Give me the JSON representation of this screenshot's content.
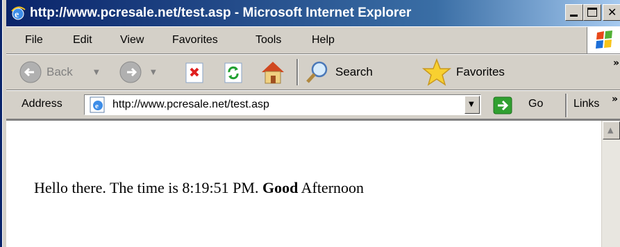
{
  "window": {
    "title": "http://www.pcresale.net/test.asp - Microsoft Internet Explorer"
  },
  "menu": {
    "items": [
      "File",
      "Edit",
      "View",
      "Favorites",
      "Tools",
      "Help"
    ]
  },
  "toolbar": {
    "back_label": "Back",
    "search_label": "Search",
    "favorites_label": "Favorites"
  },
  "address": {
    "label": "Address",
    "url": "http://www.pcresale.net/test.asp",
    "go_label": "Go",
    "links_label": "Links"
  },
  "page": {
    "text_before": "Hello there. The time is 8:19:51 PM. ",
    "bold_text": "Good",
    "text_after": " Afternoon"
  },
  "colors": {
    "titlebar_start": "#0a246a",
    "titlebar_end": "#a6caf0",
    "chrome": "#d4d0c8"
  }
}
